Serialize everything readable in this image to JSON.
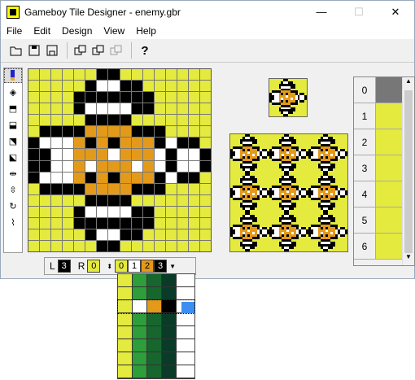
{
  "window": {
    "title": "Gameboy Tile Designer - enemy.gbr"
  },
  "caption_buttons": {
    "minimize": "—",
    "maximize": "☐",
    "close": "✕"
  },
  "menu": [
    "File",
    "Edit",
    "Design",
    "View",
    "Help"
  ],
  "toolbar": [
    "open-icon",
    "save-icon",
    "save-as-icon",
    "copy-icon",
    "paste-icon",
    "paste-disabled-icon",
    "help-icon"
  ],
  "tile_list": {
    "numbers": [
      "0",
      "1",
      "2",
      "3",
      "4",
      "5",
      "6"
    ],
    "selected": "0"
  },
  "colors": {
    "c0": "#e4ea3e",
    "c1": "#ffffff",
    "c2": "#e39a1a",
    "c3": "#000000"
  },
  "bottom_bar": {
    "left_label": "L",
    "left_value": "3",
    "right_label": "R",
    "right_value": "0",
    "palette": [
      "0",
      "1",
      "2",
      "3"
    ]
  },
  "tile_pixels": [
    "0000003300000000",
    "0000031133000000",
    "0000333333300000",
    "0000311113300000",
    "0000033330000000",
    "0333322223330000",
    "3111232322231330",
    "3311222122213113",
    "3311212221213113",
    "3111232322231330",
    "0333322223330000",
    "0000033330000000",
    "0000311113300000",
    "0000333333300000",
    "0000031133000000",
    "0000003300000000"
  ]
}
